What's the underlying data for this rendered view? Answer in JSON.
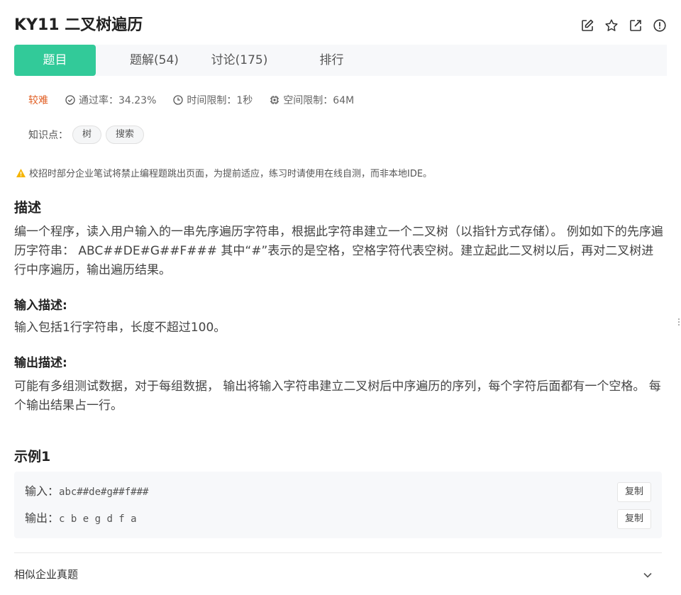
{
  "header": {
    "title": "KY11  二叉树遍历",
    "icons": [
      "edit-icon",
      "star-icon",
      "external-link-icon",
      "report-icon"
    ]
  },
  "tabs": [
    {
      "label": "题目",
      "active": true
    },
    {
      "label": "题解(54)",
      "active": false
    },
    {
      "label": "讨论(175)",
      "active": false
    },
    {
      "label": "排行",
      "active": false
    }
  ],
  "meta": {
    "difficulty": "较难",
    "pass_rate": "通过率：34.23%",
    "time_limit": "时间限制：1秒",
    "space_limit": "空间限制：64M"
  },
  "knowledge": {
    "label": "知识点：",
    "tags": [
      "树",
      "搜索"
    ]
  },
  "warning": "校招时部分企业笔试将禁止编程题跳出页面，为提前适应，练习时请使用在线自测，而非本地IDE。",
  "description": {
    "heading": "描述",
    "text": "编一个程序，读入用户输入的一串先序遍历字符串，根据此字符串建立一个二叉树（以指针方式存储）。 例如如下的先序遍历字符串： ABC##DE#G##F### 其中“#”表示的是空格，空格字符代表空树。建立起此二叉树以后，再对二叉树进行中序遍历，输出遍历结果。"
  },
  "input_desc": {
    "heading": "输入描述:",
    "text": "输入包括1行字符串，长度不超过100。"
  },
  "output_desc": {
    "heading": "输出描述:",
    "text": "可能有多组测试数据，对于每组数据， 输出将输入字符串建立二叉树后中序遍历的序列，每个字符后面都有一个空格。 每个输出结果占一行。"
  },
  "example": {
    "heading": "示例1",
    "input_label": "输入：",
    "input_value": "abc##de#g##f###",
    "output_label": "输出：",
    "output_value": "c b e g d f a",
    "copy_label": "复制"
  },
  "similar": {
    "label": "相似企业真题"
  },
  "colors": {
    "accent": "#32ca99",
    "difficulty": "#e15f24",
    "warning": "#f5b400"
  }
}
